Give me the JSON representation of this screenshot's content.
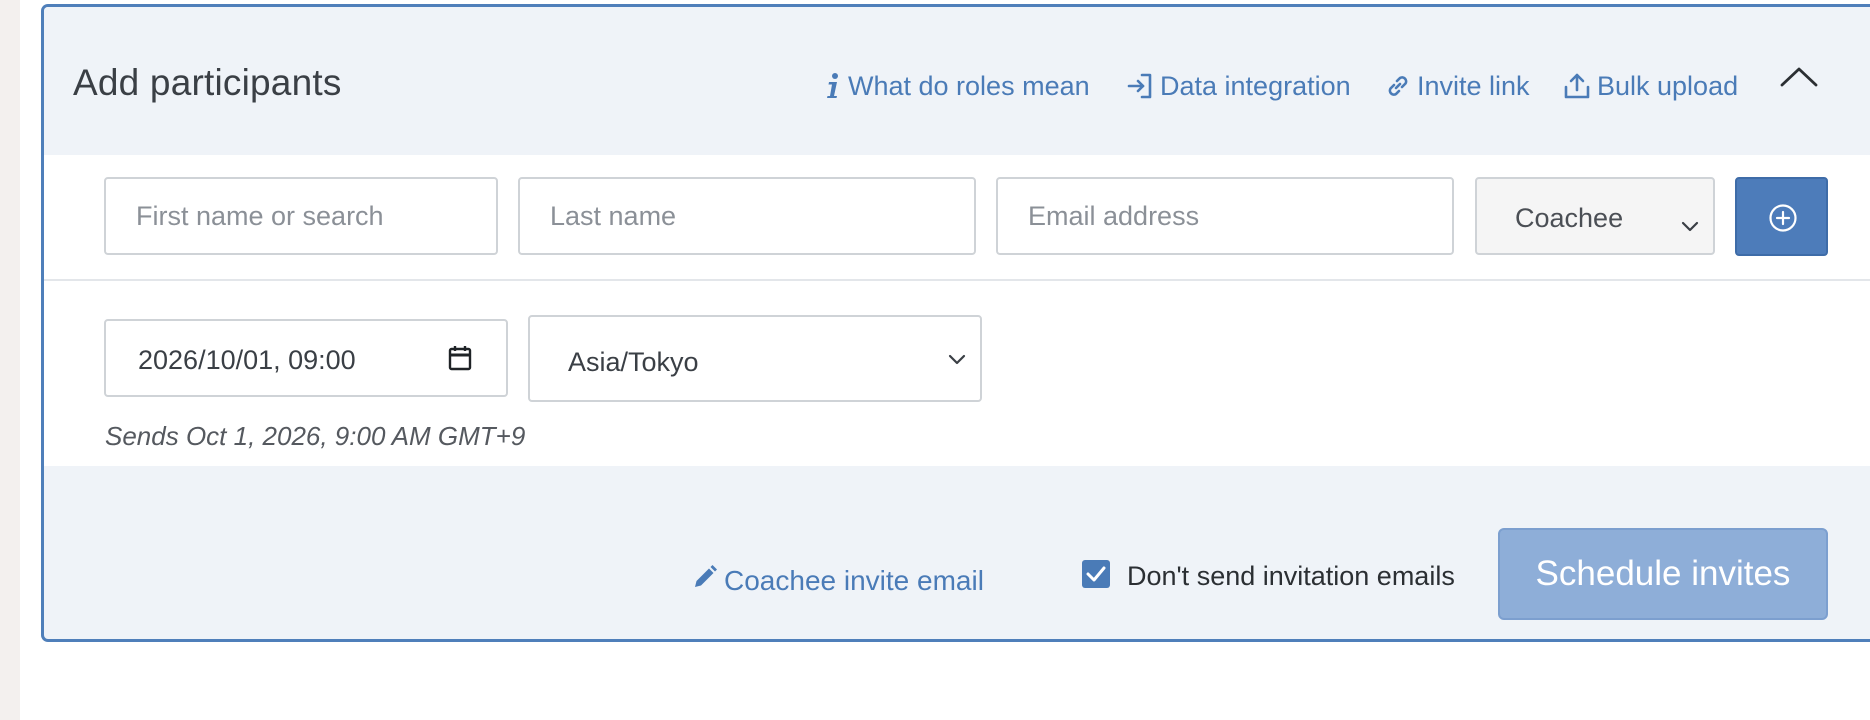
{
  "panel": {
    "title": "Add participants",
    "header_links": {
      "roles": "What do roles mean",
      "data_integration": "Data integration",
      "invite_link": "Invite link",
      "bulk_upload": "Bulk upload"
    }
  },
  "form": {
    "first_name_placeholder": "First name or search",
    "last_name_placeholder": "Last name",
    "email_placeholder": "Email address",
    "role_selected": "Coachee",
    "schedule_datetime": "2026/10/01, 09:00",
    "timezone_selected": "Asia/Tokyo",
    "sends_note": "Sends Oct 1, 2026, 9:00 AM GMT+9"
  },
  "footer": {
    "invite_email_link": "Coachee invite email",
    "dont_send_label": "Don't send invitation emails",
    "dont_send_checked": true,
    "schedule_button": "Schedule invites"
  },
  "colors": {
    "accent": "#4a7bb7",
    "panel_border": "#4f7fba",
    "panel_bg": "#eff3f8",
    "button_disabled": "#8eaed8"
  },
  "icons": {
    "roles": "info-icon",
    "data_integration": "sign-in-icon",
    "invite_link": "link-icon",
    "bulk_upload": "upload-icon",
    "collapse": "chevron-up-icon",
    "add": "plus-circle-icon",
    "calendar": "calendar-icon",
    "invite_email": "pencil-icon",
    "checkbox": "checkmark-icon"
  }
}
